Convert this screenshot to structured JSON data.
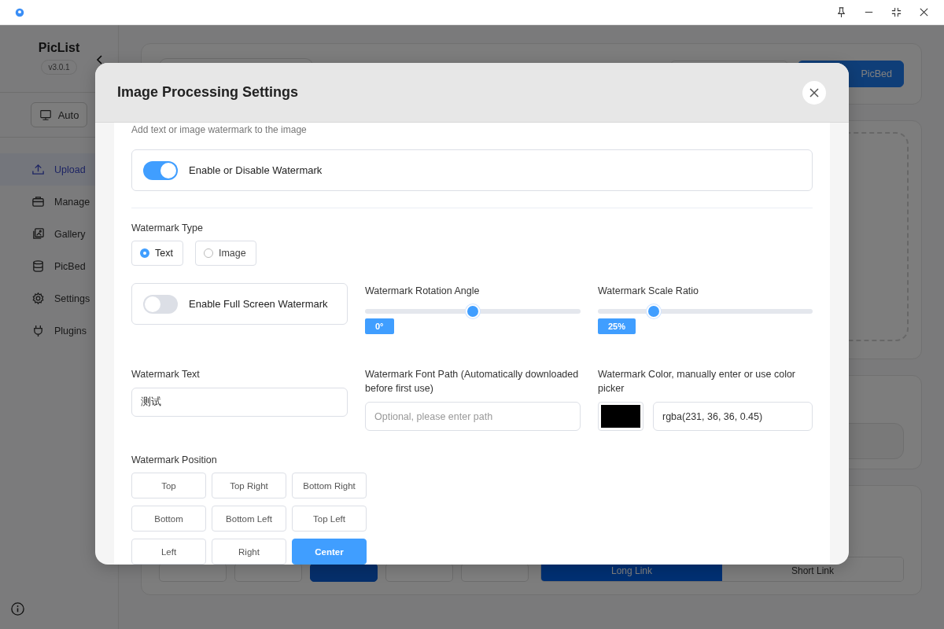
{
  "sidebar": {
    "app_name": "PicList",
    "version": "v3.0.1",
    "theme_button": "Auto",
    "items": [
      {
        "label": "Upload",
        "selected": true
      },
      {
        "label": "Manage",
        "selected": false
      },
      {
        "label": "Gallery",
        "selected": false
      },
      {
        "label": "PicBed",
        "selected": false
      },
      {
        "label": "Settings",
        "selected": false
      },
      {
        "label": "Plugins",
        "selected": false
      }
    ]
  },
  "header": {
    "change_button": "PicBed"
  },
  "bottom": {
    "format_options": [
      {
        "selected": false
      },
      {
        "selected": false
      },
      {
        "selected": true
      },
      {
        "selected": false
      },
      {
        "selected": false
      }
    ],
    "link_options": [
      {
        "label": "Long Link",
        "selected": true
      },
      {
        "label": "Short Link",
        "selected": false
      }
    ]
  },
  "dialog": {
    "title": "Image Processing Settings",
    "description": "Add text or image watermark to the image",
    "watermark_toggle": {
      "label": "Enable or Disable Watermark",
      "on": true
    },
    "type_label": "Watermark Type",
    "types": [
      {
        "label": "Text",
        "selected": true
      },
      {
        "label": "Image",
        "selected": false
      }
    ],
    "fullscreen_toggle": {
      "label": "Enable Full Screen Watermark",
      "on": false
    },
    "sliders": [
      {
        "label": "Watermark Rotation Angle",
        "level": 0.5,
        "reading": "0°"
      },
      {
        "label": "Watermark Scale Ratio",
        "level": 0.26,
        "reading": "25%"
      }
    ],
    "text_field": {
      "label": "Watermark Text",
      "value": "测试"
    },
    "font_field": {
      "label": "Watermark Font Path (Automatically downloaded before first use)",
      "placeholder": "Optional, please enter path"
    },
    "color_field": {
      "label": "Watermark Color, manually enter or use color picker",
      "value": "rgba(231, 36, 36, 0.45)"
    },
    "position_label": "Watermark Position",
    "positions": [
      {
        "label": "Top",
        "selected": false
      },
      {
        "label": "Top Right",
        "selected": false
      },
      {
        "label": "Bottom Right",
        "selected": false
      },
      {
        "label": "Bottom",
        "selected": false
      },
      {
        "label": "Bottom Left",
        "selected": false
      },
      {
        "label": "Top Left",
        "selected": false
      },
      {
        "label": "Left",
        "selected": false
      },
      {
        "label": "Right",
        "selected": false
      },
      {
        "label": "Center",
        "selected": true
      }
    ]
  }
}
